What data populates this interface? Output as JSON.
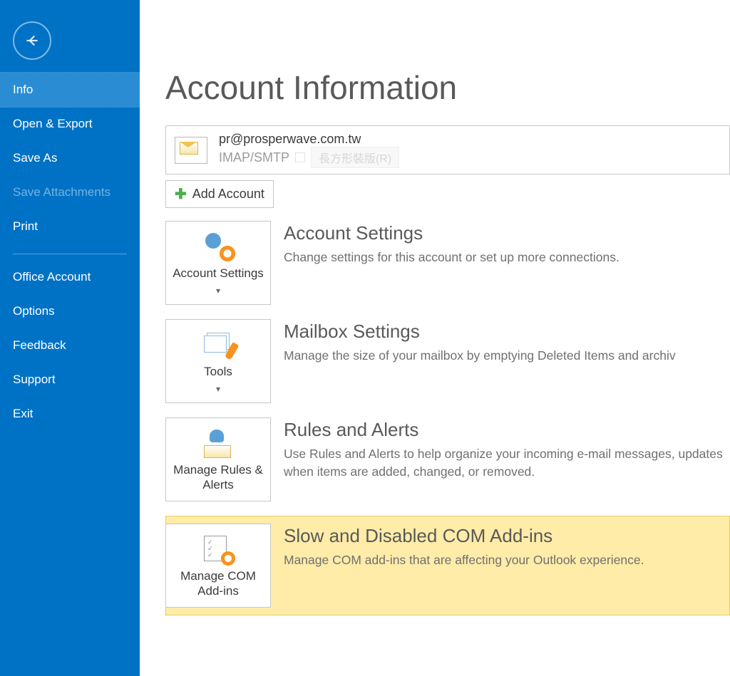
{
  "page_title": "Account Information",
  "account": {
    "email": "pr@prosperwave.com.tw",
    "type": "IMAP/SMTP",
    "ghost_label": "長方形裝版(R)"
  },
  "add_account_label": "Add Account",
  "sidebar": {
    "items": [
      {
        "label": "Info",
        "state": "selected"
      },
      {
        "label": "Open & Export",
        "state": "normal"
      },
      {
        "label": "Save As",
        "state": "normal"
      },
      {
        "label": "Save Attachments",
        "state": "disabled"
      },
      {
        "label": "Print",
        "state": "normal"
      },
      {
        "label": "Office Account",
        "state": "normal"
      },
      {
        "label": "Options",
        "state": "normal"
      },
      {
        "label": "Feedback",
        "state": "normal"
      },
      {
        "label": "Support",
        "state": "normal"
      },
      {
        "label": "Exit",
        "state": "normal"
      }
    ]
  },
  "sections": [
    {
      "tile_label": "Account Settings",
      "tile_caret": "▾",
      "title": "Account Settings",
      "desc": "Change settings for this account or set up more connections."
    },
    {
      "tile_label": "Tools",
      "tile_caret": "▾",
      "title": "Mailbox Settings",
      "desc": "Manage the size of your mailbox by emptying Deleted Items and archiv"
    },
    {
      "tile_label": "Manage Rules & Alerts",
      "tile_caret": "",
      "title": "Rules and Alerts",
      "desc": "Use Rules and Alerts to help organize your incoming e-mail messages, updates when items are added, changed, or removed."
    },
    {
      "tile_label": "Manage COM Add-ins",
      "tile_caret": "",
      "title": "Slow and Disabled COM Add-ins",
      "desc": "Manage COM add-ins that are affecting your Outlook experience.",
      "highlight": true
    }
  ],
  "colors": {
    "sidebar_bg": "#0072c6",
    "highlight_bg": "#ffeca8"
  }
}
